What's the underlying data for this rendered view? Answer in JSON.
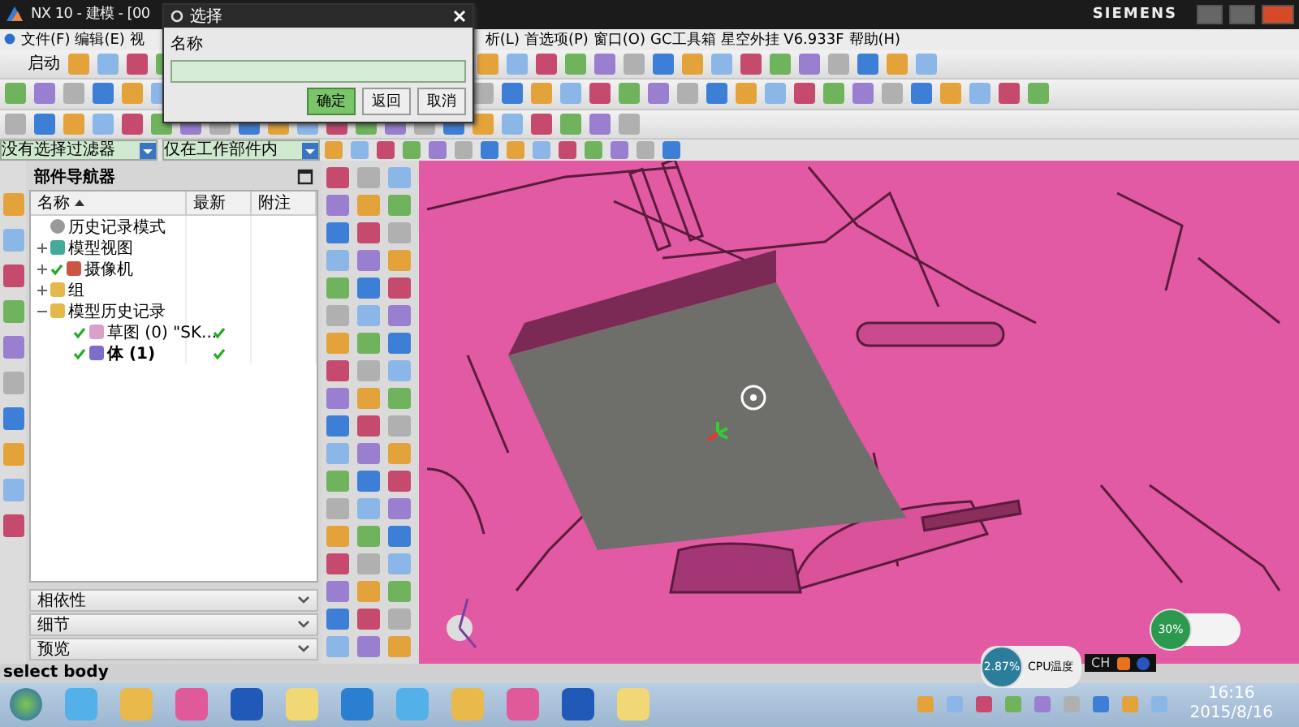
{
  "window": {
    "title": "NX 10 - 建模 - [00",
    "brand": "SIEMENS"
  },
  "menu_left": [
    "文件(F)",
    "编辑(E)",
    "视"
  ],
  "menu_right": [
    "析(L)",
    "首选项(P)",
    "窗口(O)",
    "GC工具箱",
    "星空外挂 V6.933F",
    "帮助(H)"
  ],
  "toolbar": {
    "start_label": "启动"
  },
  "filters": [
    "没有选择过滤器",
    "仅在工作部件内"
  ],
  "dialog": {
    "title": "选择",
    "label": "名称",
    "buttons": [
      {
        "label": "确定",
        "default": true
      },
      {
        "label": "返回",
        "default": false
      },
      {
        "label": "取消",
        "default": false
      }
    ]
  },
  "navigator": {
    "title": "部件导航器",
    "columns": [
      "名称",
      "最新",
      "附注"
    ],
    "items": [
      {
        "label": "历史记录模式",
        "kind": "mode"
      },
      {
        "label": "模型视图",
        "kind": "views",
        "expanded": false
      },
      {
        "label": "摄像机",
        "kind": "camera",
        "expanded": false,
        "checked": true
      },
      {
        "label": "组",
        "kind": "folder",
        "expanded": false
      },
      {
        "label": "模型历史记录",
        "kind": "folder",
        "expanded": true,
        "children": [
          {
            "label": "草图 (0) \"SK...",
            "kind": "sketch",
            "checked": true,
            "latest": true,
            "current": false
          },
          {
            "label": "体 (1)",
            "kind": "body",
            "checked": true,
            "latest": true,
            "current": true
          }
        ]
      }
    ],
    "sections": [
      {
        "label": "相依性",
        "expanded": false
      },
      {
        "label": "细节",
        "expanded": false
      },
      {
        "label": "预览",
        "expanded": false
      }
    ]
  },
  "status_bar": "select body",
  "widgets": {
    "cpu": "2.87%",
    "cpu_label": "CPU温度",
    "ime": "CH",
    "memory": "30%"
  },
  "taskbar": {
    "time": "16:16",
    "date": "2015/8/16"
  }
}
